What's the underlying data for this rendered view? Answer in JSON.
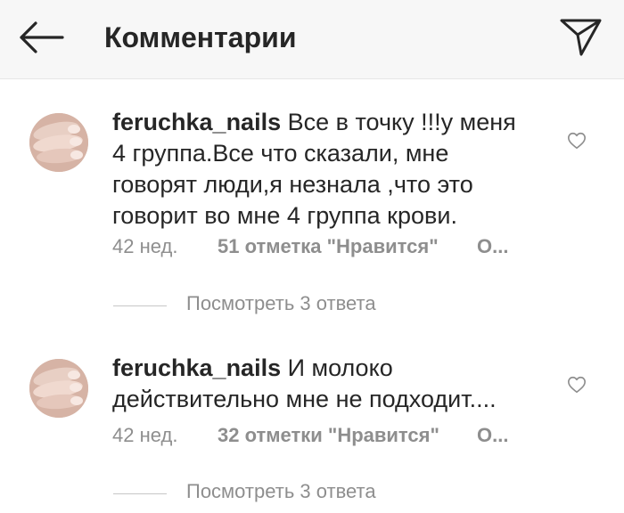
{
  "header": {
    "title": "Комментарии",
    "back_icon": "back-arrow-icon",
    "send_icon": "paper-plane-icon"
  },
  "comments": [
    {
      "username": "feruchka_nails",
      "text": "Все в точку !!!у меня 4 группа.Все что сказали, мне говорят люди,я незнала ,что это говорит во мне 4 группа крови.",
      "time": "42 нед.",
      "likes": "51 отметка \"Нравится\"",
      "reply": "О...",
      "view_replies": "Посмотреть 3 ответа",
      "avatar_icon": "nails-photo-avatar",
      "like_icon": "heart-outline-icon"
    },
    {
      "username": "feruchka_nails",
      "text": "И молоко действительно мне не подходит....",
      "time": "42 нед.",
      "likes": "32 отметки \"Нравится\"",
      "reply": "О...",
      "view_replies": "Посмотреть 3 ответа",
      "avatar_icon": "nails-photo-avatar",
      "like_icon": "heart-outline-icon"
    }
  ],
  "colors": {
    "text": "#262626",
    "secondary": "#8e8e8e",
    "header_bg": "#f7f7f7"
  }
}
